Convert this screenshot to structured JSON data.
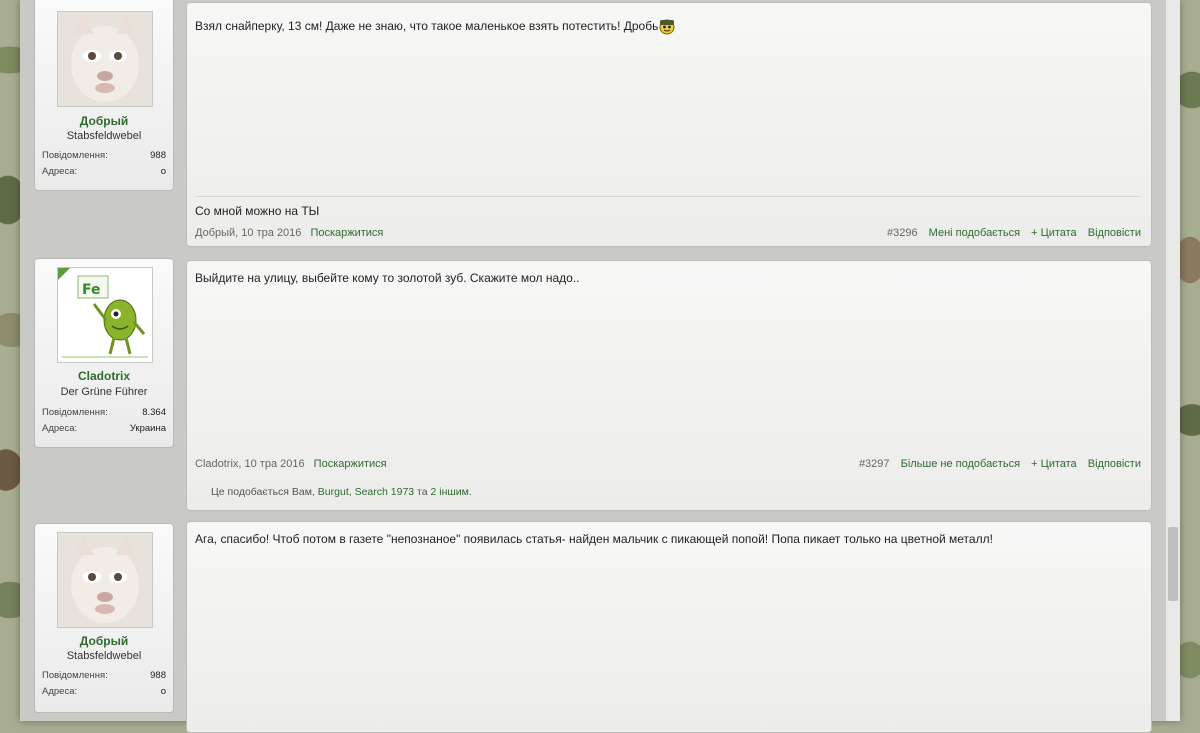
{
  "posts": [
    {
      "user": {
        "name": "Добрый",
        "title": "Stabsfeldwebel",
        "messages_label": "Повідомлення:",
        "messages": "988",
        "address_label": "Адреса:",
        "address": "о"
      },
      "text": "Взял снайперку, 13 см! Даже не знаю, что такое маленькое взять потестить! Дробь",
      "signature": "Со мной можно на ТЫ",
      "author_date": "Добрый, 10 тра 2016",
      "report": "Поскаржитися",
      "number": "#3296",
      "like": "Мені подобається",
      "quote": "+ Цитата",
      "reply": "Відповісти"
    },
    {
      "user": {
        "name": "Cladotrix",
        "title": "Der Grüne Führer",
        "messages_label": "Повідомлення:",
        "messages": "8.364",
        "address_label": "Адреса:",
        "address": "Украина",
        "avatar_text": "Fe"
      },
      "text": "Выйдите на улицу, выбейте кому то золотой зуб. Скажите мол надо..",
      "author_date": "Cladotrix, 10 тра 2016",
      "report": "Поскаржитися",
      "number": "#3297",
      "like": "Більше не подобається",
      "quote": "+ Цитата",
      "reply": "Відповісти",
      "likes_prefix": "Це подобається Вам, ",
      "likes_user1": "Burgut",
      "likes_sep": ", ",
      "likes_user2": "Search 1973",
      "likes_and": " та ",
      "likes_others": "2 іншим",
      "likes_end": "."
    },
    {
      "user": {
        "name": "Добрый",
        "title": "Stabsfeldwebel",
        "messages_label": "Повідомлення:",
        "messages": "988",
        "address_label": "Адреса:",
        "address": "о"
      },
      "text": "Ага, спасибо! Чтоб потом в газете \"непознаное\" появилась статья- найден мальчик с пикающей попой! Попа пикает только на цветной металл!"
    }
  ]
}
